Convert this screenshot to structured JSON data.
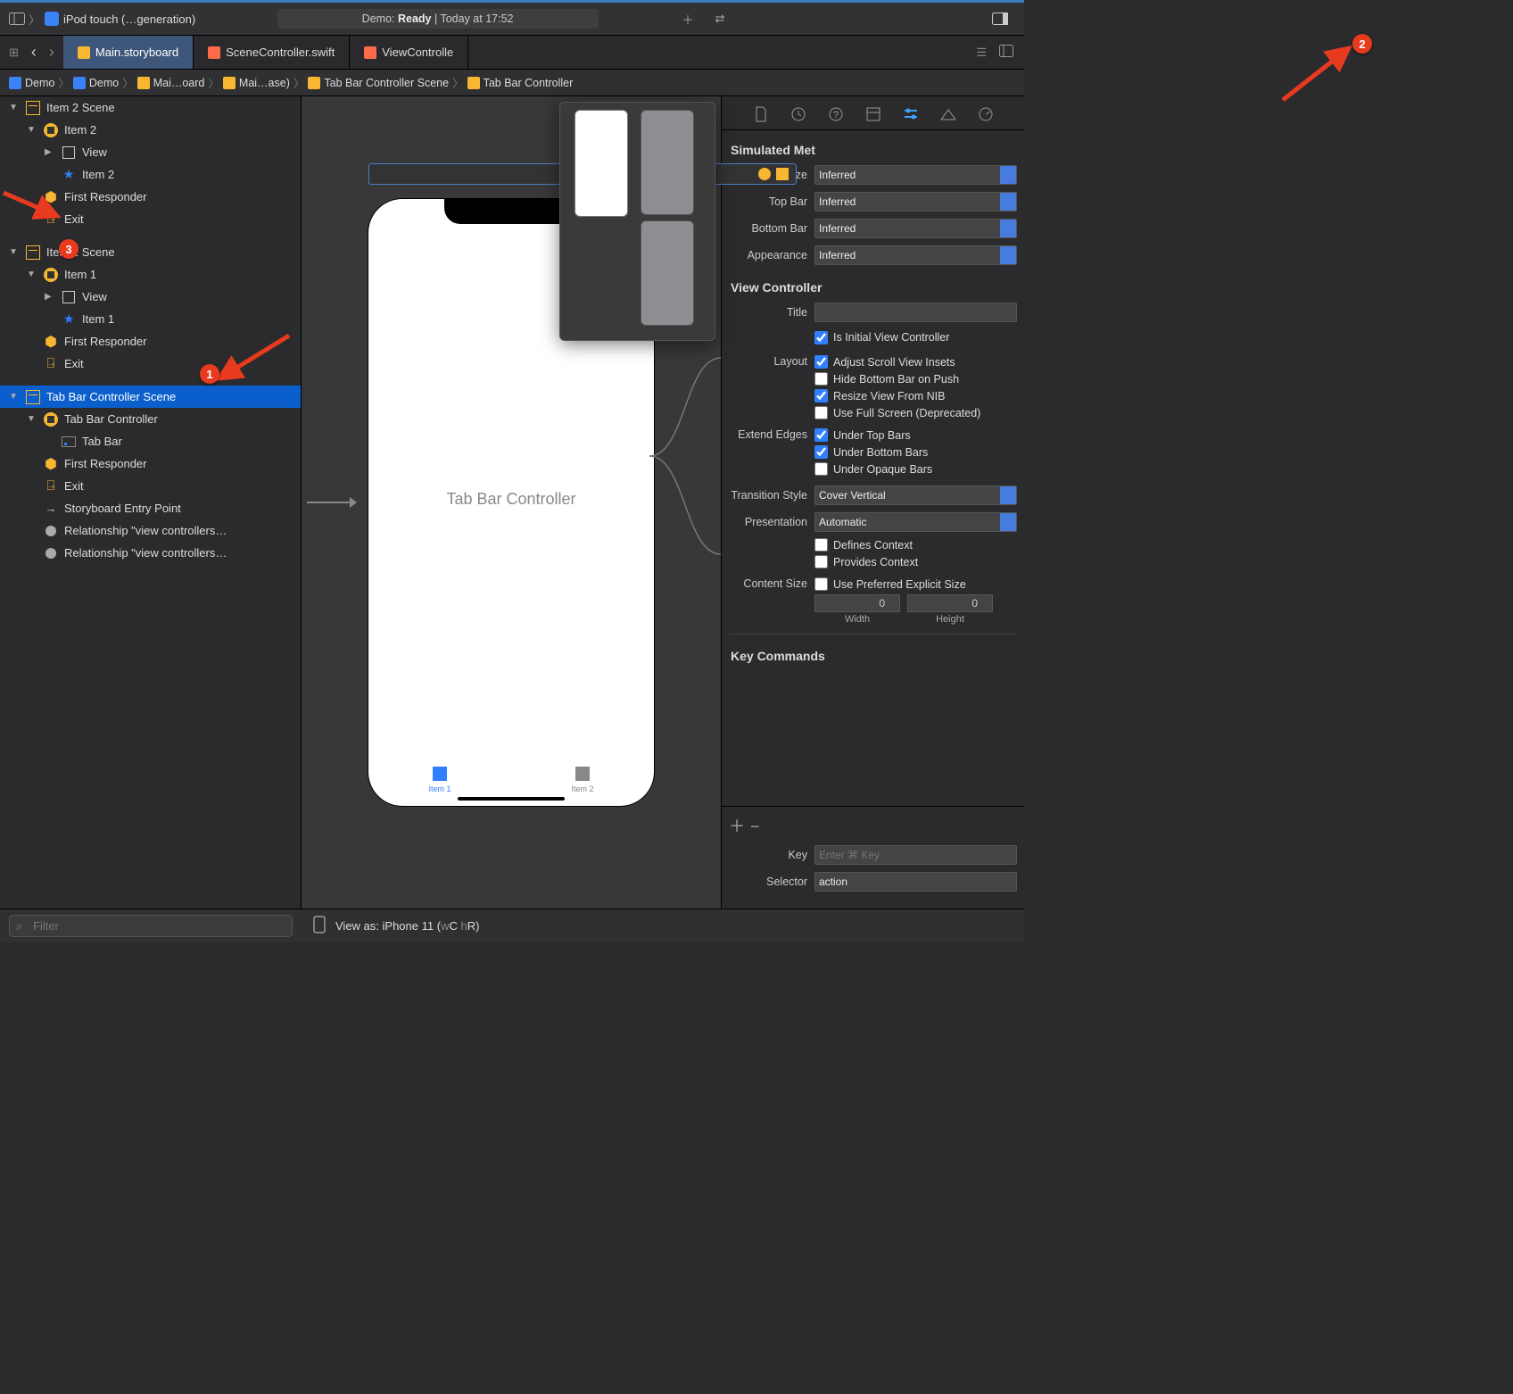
{
  "titlebar": {
    "scheme_icon_color": "#3b82f6",
    "device": "iPod touch (…generation)",
    "status_prefix": "Demo: ",
    "status_state": "Ready",
    "status_sep": " | ",
    "status_time": "Today at 17:52"
  },
  "tabs": {
    "items": [
      {
        "label": "Main.storyboard",
        "active": true,
        "icon_color": "#f7b731"
      },
      {
        "label": "SceneController.swift",
        "active": false,
        "icon_color": "#ff6b4a"
      },
      {
        "label": "ViewControlle",
        "active": false,
        "icon_color": "#ff6b4a"
      }
    ]
  },
  "breadcrumb": {
    "items": [
      "Demo",
      "Demo",
      "Mai…oard",
      "Mai…ase)",
      "Tab Bar Controller Scene",
      "Tab Bar Controller"
    ]
  },
  "outline": {
    "rows": [
      {
        "depth": 0,
        "disc": "▼",
        "icon": "scene",
        "label": "Item 2 Scene"
      },
      {
        "depth": 1,
        "disc": "▼",
        "icon": "vc",
        "label": "Item 2"
      },
      {
        "depth": 2,
        "disc": "▶",
        "icon": "view",
        "label": "View"
      },
      {
        "depth": 2,
        "disc": "",
        "icon": "star",
        "label": "Item 2"
      },
      {
        "depth": 1,
        "disc": "",
        "icon": "cube",
        "label": "First Responder"
      },
      {
        "depth": 1,
        "disc": "",
        "icon": "exit",
        "label": "Exit"
      },
      {
        "depth": 0,
        "disc": "▼",
        "icon": "scene",
        "label": "Item 1 Scene",
        "gap": true
      },
      {
        "depth": 1,
        "disc": "▼",
        "icon": "vc",
        "label": "Item 1"
      },
      {
        "depth": 2,
        "disc": "▶",
        "icon": "view",
        "label": "View"
      },
      {
        "depth": 2,
        "disc": "",
        "icon": "star",
        "label": "Item 1"
      },
      {
        "depth": 1,
        "disc": "",
        "icon": "cube",
        "label": "First Responder"
      },
      {
        "depth": 1,
        "disc": "",
        "icon": "exit",
        "label": "Exit"
      },
      {
        "depth": 0,
        "disc": "▼",
        "icon": "scene",
        "label": "Tab Bar Controller Scene",
        "gap": true,
        "selected": true
      },
      {
        "depth": 1,
        "disc": "▼",
        "icon": "vc",
        "label": "Tab Bar Controller"
      },
      {
        "depth": 2,
        "disc": "",
        "icon": "tabbar",
        "label": "Tab Bar"
      },
      {
        "depth": 1,
        "disc": "",
        "icon": "cube",
        "label": "First Responder"
      },
      {
        "depth": 1,
        "disc": "",
        "icon": "exit",
        "label": "Exit"
      },
      {
        "depth": 1,
        "disc": "",
        "icon": "arrow",
        "label": "Storyboard Entry Point"
      },
      {
        "depth": 1,
        "disc": "",
        "icon": "circle",
        "label": "Relationship \"view controllers…"
      },
      {
        "depth": 1,
        "disc": "",
        "icon": "circle",
        "label": "Relationship \"view controllers…"
      }
    ]
  },
  "canvas": {
    "title": "Tab Bar Controller",
    "tab_items": [
      {
        "label": "Item 1",
        "color": "#2f7fff"
      },
      {
        "label": "Item 2",
        "color": "#888"
      }
    ]
  },
  "inspector": {
    "section_sim": "Simulated Met",
    "rows_sim": [
      {
        "label": "ize",
        "value": "Inferred"
      },
      {
        "label": "Top Bar",
        "value": "Inferred"
      },
      {
        "label": "Bottom Bar",
        "value": "Inferred"
      },
      {
        "label": "Appearance",
        "value": "Inferred"
      }
    ],
    "section_vc": "View Controller",
    "title_label": "Title",
    "title_value": "",
    "checks_initial": {
      "label": "Is Initial View Controller",
      "checked": true
    },
    "layout_label": "Layout",
    "layout_checks": [
      {
        "label": "Adjust Scroll View Insets",
        "checked": true
      },
      {
        "label": "Hide Bottom Bar on Push",
        "checked": false
      },
      {
        "label": "Resize View From NIB",
        "checked": true
      },
      {
        "label": "Use Full Screen (Deprecated)",
        "checked": false
      }
    ],
    "extend_label": "Extend Edges",
    "extend_checks": [
      {
        "label": "Under Top Bars",
        "checked": true
      },
      {
        "label": "Under Bottom Bars",
        "checked": true
      },
      {
        "label": "Under Opaque Bars",
        "checked": false
      }
    ],
    "transition": {
      "label": "Transition Style",
      "value": "Cover Vertical"
    },
    "presentation": {
      "label": "Presentation",
      "value": "Automatic"
    },
    "context_checks": [
      {
        "label": "Defines Context",
        "checked": false
      },
      {
        "label": "Provides Context",
        "checked": false
      }
    ],
    "content_size_label": "Content Size",
    "content_size_check": {
      "label": "Use Preferred Explicit Size",
      "checked": false
    },
    "width_label": "Width",
    "width_value": "0",
    "height_label": "Height",
    "height_value": "0",
    "section_keycmd": "Key Commands",
    "footer": {
      "key_label": "Key",
      "key_placeholder": "Enter ⌘ Key",
      "sel_label": "Selector",
      "sel_value": "action"
    }
  },
  "bottom": {
    "filter_placeholder": "Filter",
    "view_as_prefix": "View as: ",
    "view_as_device": "iPhone 11 ",
    "view_as_traits_open": "(",
    "view_as_w": "w",
    "view_as_C": "C ",
    "view_as_h": "h",
    "view_as_R": "R",
    "view_as_traits_close": ")"
  },
  "annotations": {
    "a1": "1",
    "a2": "2",
    "a3": "3"
  }
}
